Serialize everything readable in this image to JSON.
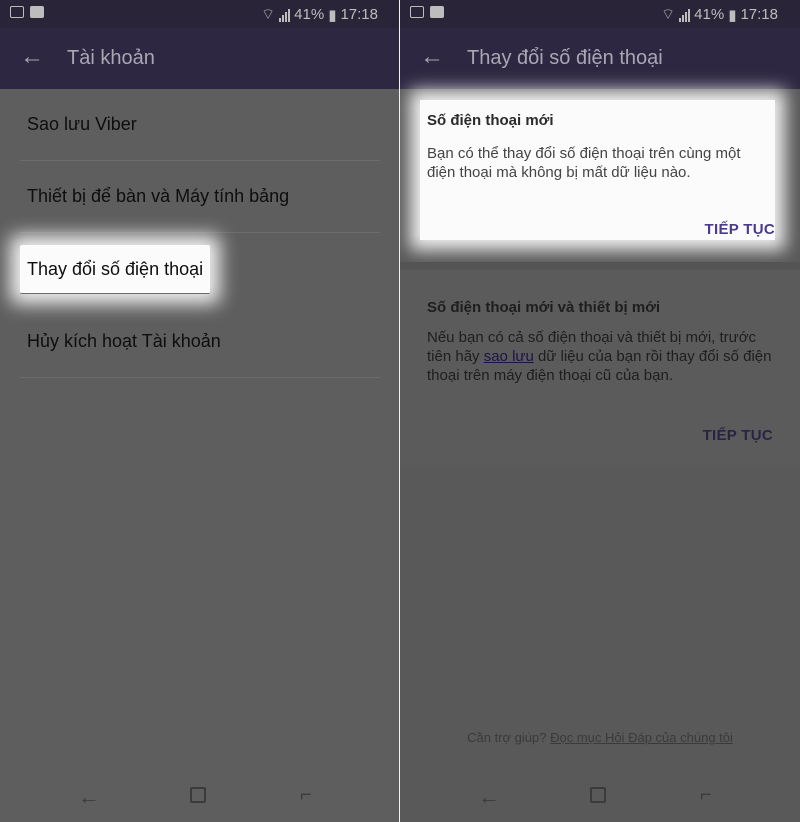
{
  "status": {
    "battery": "41%",
    "time": "17:18"
  },
  "left": {
    "appbar": {
      "title": "Tài khoản"
    },
    "items": [
      {
        "label": "Sao lưu Viber"
      },
      {
        "label": "Thiết bị để bàn và Máy tính bảng"
      },
      {
        "label": "Thay đổi số điện thoại"
      },
      {
        "label": "Hủy kích hoạt Tài khoản"
      }
    ]
  },
  "right": {
    "appbar": {
      "title": "Thay đổi số điện thoại"
    },
    "card1": {
      "title": "Số điện thoại mới",
      "body": "Bạn có thể thay đổi số điện thoại trên cùng một điện thoại mà không bị mất dữ liệu nào.",
      "action": "TIẾP TỤC"
    },
    "card2": {
      "title": "Số điện thoại mới và thiết bị mới",
      "body_pre": "Nếu bạn có cả số điện thoại và thiết bị mới, trước tiên hãy ",
      "body_link": "sao lưu",
      "body_post": " dữ liệu của bạn rồi thay đổi số điện thoại trên máy điện thoại cũ của bạn.",
      "action": "TIẾP TỤC"
    },
    "help": {
      "prefix": "Cần trợ giúp? ",
      "link": "Đọc mục Hỏi Đáp của chúng tôi"
    }
  },
  "icons": {
    "back": "back-arrow-icon",
    "image": "image-icon",
    "chat": "chat-icon",
    "wifi": "wifi-icon",
    "signal": "signal-icon",
    "battery": "battery-icon"
  }
}
